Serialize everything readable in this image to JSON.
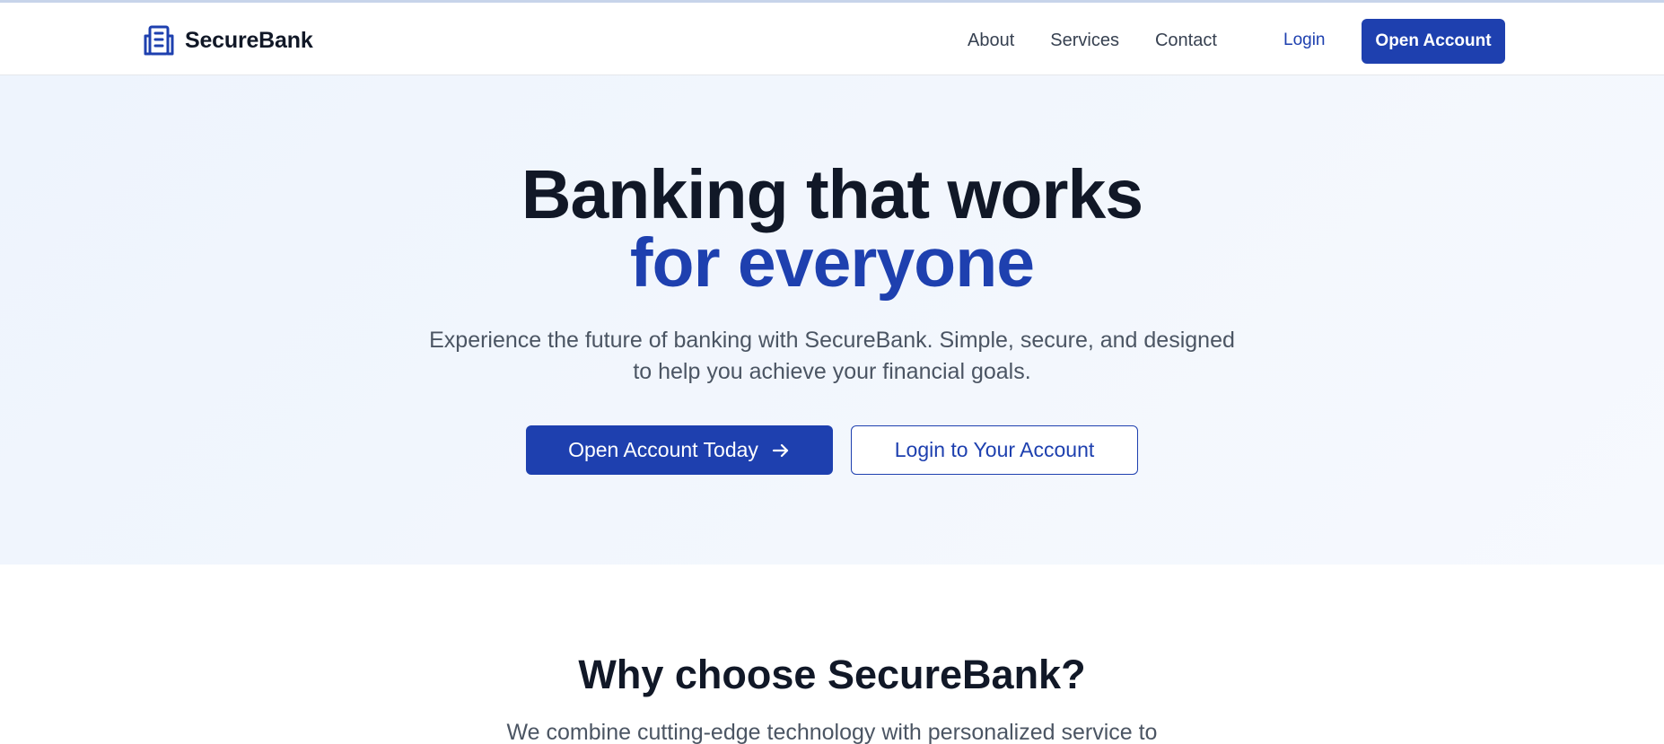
{
  "brand": {
    "name": "SecureBank",
    "icon": "bank-building-icon",
    "accent_color": "#1e40af"
  },
  "nav": {
    "links": [
      "About",
      "Services",
      "Contact"
    ],
    "login_label": "Login",
    "open_account_label": "Open Account"
  },
  "hero": {
    "title_line1": "Banking that works",
    "title_line2": "for everyone",
    "subtitle_line1": "Experience the future of banking with SecureBank. Simple, secure, and designed",
    "subtitle_line2": "to help you achieve your financial goals.",
    "primary_cta": "Open Account Today",
    "primary_cta_icon": "arrow-right-icon",
    "secondary_cta": "Login to Your Account"
  },
  "why": {
    "title": "Why choose SecureBank?",
    "subtitle": "We combine cutting-edge technology with personalized service to"
  }
}
